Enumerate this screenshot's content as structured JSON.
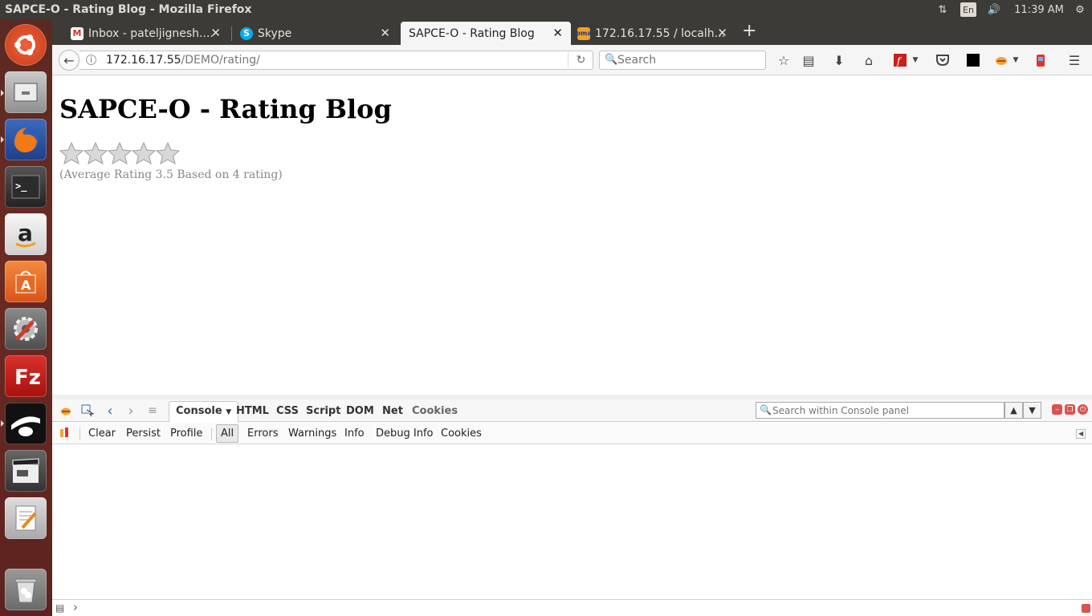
{
  "system_bar": {
    "window_title": "SAPCE-O - Rating Blog - Mozilla Firefox",
    "keyboard_layout": "En",
    "clock": "11:39 AM"
  },
  "launcher": {
    "items": [
      "ubuntu-dash",
      "files",
      "firefox",
      "terminal",
      "amazon",
      "software-center",
      "system-settings",
      "filezilla",
      "app-eye",
      "video-editor",
      "text-editor",
      "trash"
    ]
  },
  "tabs": [
    {
      "label": "Inbox - pateljignesh....",
      "icon": "gmail-icon",
      "active": false
    },
    {
      "label": "Skype",
      "icon": "skype-icon",
      "active": false
    },
    {
      "label": "SAPCE-O - Rating Blog",
      "icon": "",
      "active": true
    },
    {
      "label": "172.16.17.55 / localh...",
      "icon": "phpmyadmin-icon",
      "active": false
    }
  ],
  "navbar": {
    "url_host": "172.16.17.55",
    "url_path": "/DEMO/rating/",
    "search_placeholder": "Search"
  },
  "page": {
    "heading": "SAPCE-O - Rating Blog",
    "rating_stars_total": 5,
    "average_text": "(Average Rating 3.5 Based on 4 rating)"
  },
  "firebug": {
    "tabs": [
      "Console",
      "HTML",
      "CSS",
      "Script",
      "DOM",
      "Net",
      "Cookies"
    ],
    "active_tab": "Console",
    "search_placeholder": "Search within Console panel",
    "console_buttons": [
      "Clear",
      "Persist",
      "Profile"
    ],
    "filters": [
      "All",
      "Errors",
      "Warnings",
      "Info",
      "Debug Info",
      "Cookies"
    ],
    "active_filter": "All",
    "cmd_prompt": "›"
  },
  "colors": {
    "system_bar": "#3c3b37",
    "launcher": "#6b2a22",
    "star_fill": "#d8d8d8"
  }
}
